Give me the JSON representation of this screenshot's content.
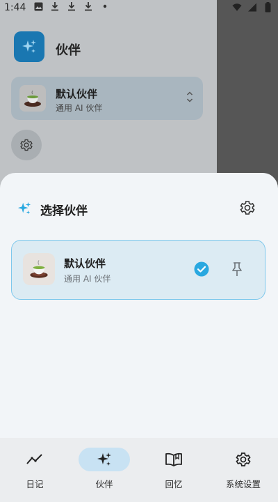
{
  "status_bar": {
    "time": "1:44"
  },
  "background_screen": {
    "title": "伙伴",
    "partner": {
      "name": "默认伙伴",
      "description": "通用 AI 伙伴"
    }
  },
  "sheet": {
    "title": "选择伙伴",
    "partner": {
      "name": "默认伙伴",
      "description": "通用 AI 伙伴",
      "selected": true
    }
  },
  "bottom_nav": {
    "items": [
      {
        "label": "日记",
        "icon": "trend-line-icon"
      },
      {
        "label": "伙伴",
        "icon": "sparkle-icon",
        "active": true
      },
      {
        "label": "回忆",
        "icon": "book-icon"
      },
      {
        "label": "系统设置",
        "icon": "gear-icon"
      }
    ]
  },
  "colors": {
    "accent": "#29a8e0",
    "selected_card": "#dcebf3",
    "active_nav": "#c8e2f3"
  }
}
